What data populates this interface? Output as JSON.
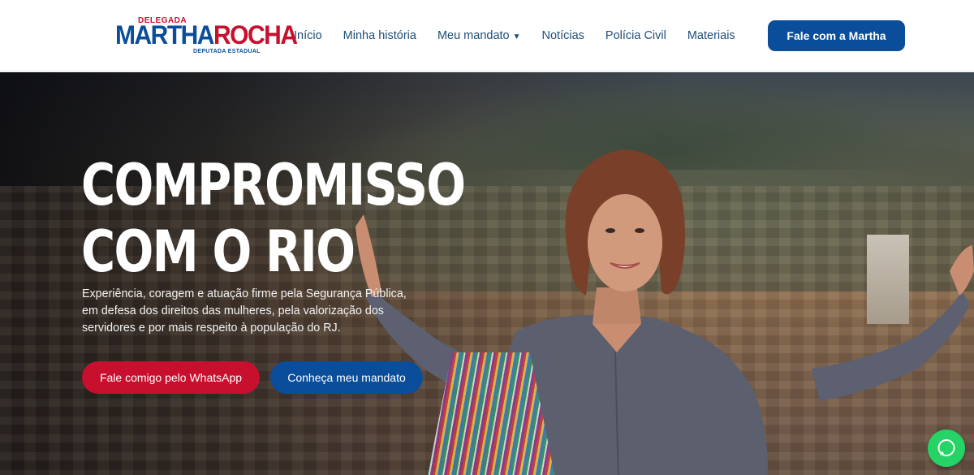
{
  "logo": {
    "top_text": "DELEGADA",
    "name_part1": "MARTHA",
    "name_part2": "ROCHA",
    "subtitle": "DEPUTADA ESTADUAL"
  },
  "nav": {
    "items": [
      {
        "label": "Início"
      },
      {
        "label": "Minha história"
      },
      {
        "label": "Meu mandato",
        "has_dropdown": true
      },
      {
        "label": "Notícias"
      },
      {
        "label": "Polícia Civil"
      },
      {
        "label": "Materiais"
      }
    ],
    "dropdown_caret": "▼",
    "cta_label": "Fale com a Martha"
  },
  "hero": {
    "title_line1": "COMPROMISSO",
    "title_line2": "COM O RIO",
    "description": "Experiência, coragem e atuação firme pela Segurança Pública, em defesa dos direitos das mulheres, pela valorização dos servidores e por mais respeito à população do RJ.",
    "primary_button": "Fale comigo pelo WhatsApp",
    "secondary_button": "Conheça meu mandato"
  },
  "floating": {
    "icon": "whatsapp-icon"
  },
  "colors": {
    "brand_blue": "#0a4e9b",
    "brand_red": "#c8102e",
    "whatsapp_green": "#25d366"
  }
}
